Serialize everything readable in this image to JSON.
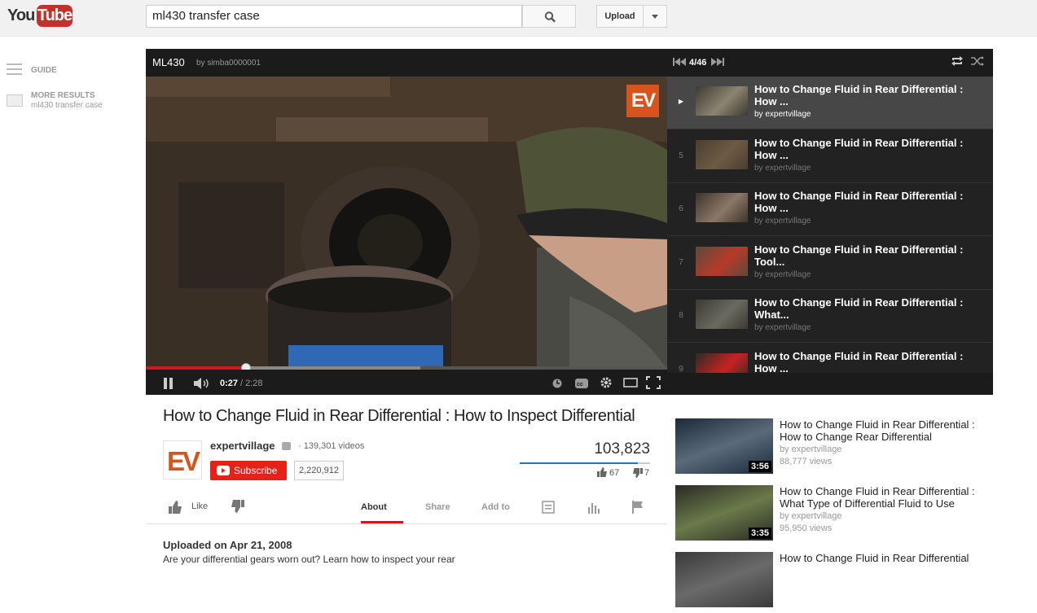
{
  "header": {
    "logo_you": "You",
    "logo_tube": "Tube",
    "search_value": "ml430 transfer case",
    "upload_label": "Upload"
  },
  "guide": {
    "guide_label": "GUIDE",
    "more_results_label": "MORE RESULTS",
    "more_results_query": "ml430 transfer case"
  },
  "player": {
    "title": "ML430",
    "by": "by simba0000001",
    "watermark": "EV",
    "time_current": "0:27",
    "time_total": "/ 2:28",
    "progress_played_fraction": 0.192,
    "progress_loaded_fraction": 0.526
  },
  "playlist": {
    "position": "4/46",
    "items": [
      {
        "num": "",
        "title": "How to Change Fluid in Rear Differential : How ...",
        "owner": "by expertvillage",
        "active": true
      },
      {
        "num": "5",
        "title": "How to Change Fluid in Rear Differential : How ...",
        "owner": "by expertvillage"
      },
      {
        "num": "6",
        "title": "How to Change Fluid in Rear Differential : How ...",
        "owner": "by expertvillage"
      },
      {
        "num": "7",
        "title": "How to Change Fluid in Rear Differential : Tool...",
        "owner": "by expertvillage"
      },
      {
        "num": "8",
        "title": "How to Change Fluid in Rear Differential : What...",
        "owner": "by expertvillage"
      },
      {
        "num": "9",
        "title": "How to Change Fluid in Rear Differential : How ...",
        "owner": "by expertvillage"
      }
    ]
  },
  "watch": {
    "title": "How to Change Fluid in Rear Differential : How to Inspect Differential",
    "channel_avatar_text": "EV",
    "channel_name": "expertvillage",
    "channel_videos": "· 139,301 videos",
    "subscribe_label": "Subscribe",
    "subscriber_count": "2,220,912",
    "view_count": "103,823",
    "likes": "67",
    "dislikes": "7",
    "like_fraction": 0.905,
    "like_label": "Like",
    "tabs": {
      "about": "About",
      "share": "Share",
      "add_to": "Add to"
    },
    "upload_date": "Uploaded on Apr 21, 2008",
    "description": "Are your differential gears worn out? Learn how to inspect your rear"
  },
  "related": [
    {
      "title": "How to Change Fluid in Rear Differential : How to Change Rear Differential",
      "owner": "by expertvillage",
      "views": "88,777 views",
      "duration": "3:56"
    },
    {
      "title": "How to Change Fluid in Rear Differential : What Type of Differential Fluid to Use",
      "owner": "by expertvillage",
      "views": "95,950 views",
      "duration": "3:35"
    },
    {
      "title": "How to Change Fluid in Rear Differential",
      "owner": "",
      "views": "",
      "duration": ""
    }
  ],
  "colors": {
    "accent": "#cc181e",
    "ev_orange": "#d8541c",
    "subscribe": "#e62117",
    "like_blue": "#167ac6"
  }
}
